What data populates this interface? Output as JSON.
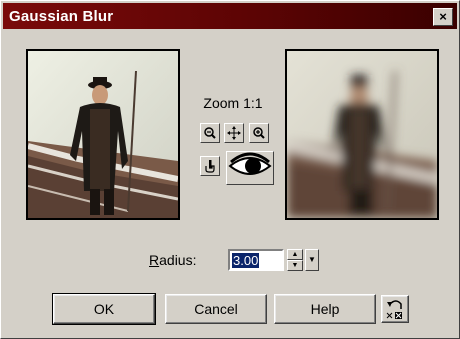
{
  "window": {
    "title": "Gaussian Blur",
    "close_glyph": "×"
  },
  "preview": {
    "zoom_label": "Zoom 1:1",
    "left_name": "original-preview",
    "right_name": "blurred-preview"
  },
  "toolbar": {
    "zoom_out_icon": "zoom-out-icon",
    "pan_icon": "move-icon",
    "zoom_in_icon": "zoom-in-icon",
    "locate_icon": "hand-pointer-icon",
    "eye_icon": "eye-icon"
  },
  "radius": {
    "label_rest": "adius:",
    "label_accel": "R",
    "value": "3.00"
  },
  "buttons": {
    "ok": "OK",
    "cancel": "Cancel",
    "help": "Help",
    "reset_icon": "reset-icon"
  },
  "colors": {
    "title_bar": "#7a0a0a",
    "selection": "#0a246a",
    "face": "#d4d0c8"
  }
}
